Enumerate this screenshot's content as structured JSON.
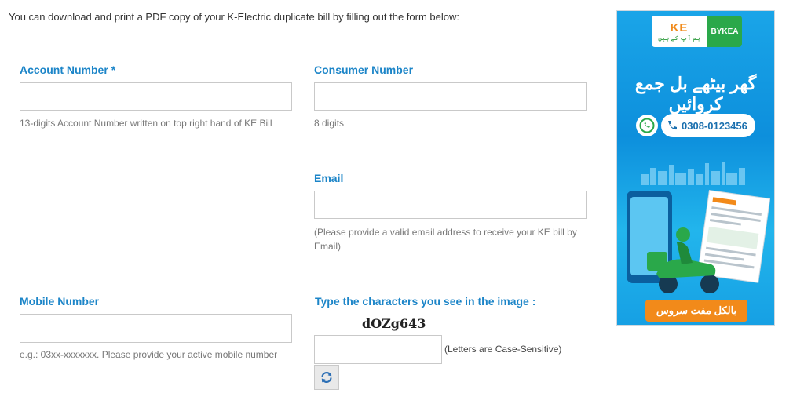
{
  "intro": "You can download and print a PDF copy of your K-Electric duplicate bill by filling out the form below:",
  "form": {
    "account_number": {
      "label": "Account Number",
      "required_mark": "*",
      "value": "",
      "help": "13-digits Account Number written on top right hand of KE Bill"
    },
    "consumer_number": {
      "label": "Consumer Number",
      "value": "",
      "help": "8 digits"
    },
    "email": {
      "label": "Email",
      "value": "",
      "help": "(Please provide a valid email address to receive your KE bill by Email)"
    },
    "mobile_number": {
      "label": "Mobile Number",
      "value": "",
      "help": "e.g.: 03xx-xxxxxxx. Please provide your active mobile number"
    },
    "captcha": {
      "label": "Type the characters you see in the image :",
      "image_text": "dOZg643",
      "value": "",
      "note": "(Letters are Case-Sensitive)",
      "refresh_icon": "refresh-icon"
    }
  },
  "ad": {
    "ke_logo_text": "KE",
    "ke_tagline": "ہم آپ کے ہیں",
    "partner_logo": "BYKEA",
    "heading": "گھر بیٹھے بل جمع کروائیں",
    "phone": "0308-0123456",
    "footer": "بالکل مفت سروس",
    "colors": {
      "background": "#1aa5e8",
      "accent": "#f28a1a",
      "partner": "#2aa84a"
    }
  },
  "colors": {
    "label": "#1c85c8",
    "help_text": "#777777",
    "border": "#c9c9c9"
  }
}
